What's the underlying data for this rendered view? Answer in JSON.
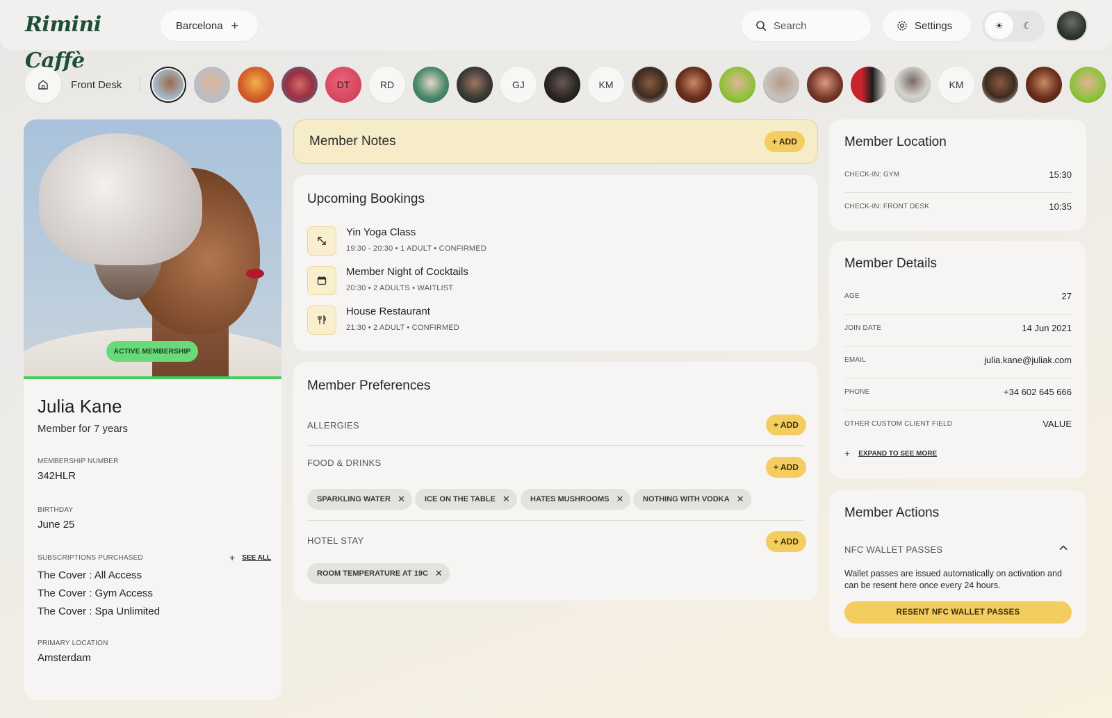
{
  "brand": {
    "logo_text": "Rimini Caffè"
  },
  "header": {
    "location": "Barcelona",
    "search_placeholder": "Search",
    "settings_label": "Settings"
  },
  "desk": {
    "label": "Front Desk"
  },
  "profile": {
    "badge": "ACTIVE MEMBERSHIP",
    "name": "Julia Kane",
    "member_since": "Member for 7 years",
    "membership_number_label": "MEMBERSHIP NUMBER",
    "membership_number": "342HLR",
    "birthday_label": "BIRTHDAY",
    "birthday": "June 25",
    "subscriptions_label": "SUBSCRIPTIONS PURCHASED",
    "see_all": "SEE ALL",
    "subscriptions": [
      "The Cover : All Access",
      "The Cover : Gym Access",
      "The Cover : Spa Unlimited"
    ],
    "primary_location_label": "PRIMARY LOCATION",
    "primary_location": "Amsterdam"
  },
  "notes": {
    "title": "Member Notes",
    "add": "+ ADD"
  },
  "bookings": {
    "title": "Upcoming Bookings",
    "items": [
      {
        "name": "Yin Yoga Class",
        "meta": "19:30 - 20:30 • 1 ADULT • CONFIRMED",
        "icon": "expand-arrows-icon"
      },
      {
        "name": "Member Night of Cocktails",
        "meta": "20:30 • 2 ADULTS • WAITLIST",
        "icon": "calendar-icon"
      },
      {
        "name": "House Restaurant",
        "meta": "21:30 • 2 ADULT • CONFIRMED",
        "icon": "cutlery-icon"
      }
    ]
  },
  "preferences": {
    "title": "Member Preferences",
    "add": "+ ADD",
    "allergies_label": "ALLERGIES",
    "food_label": "FOOD & DRINKS",
    "food_tags": [
      "SPARKLING WATER",
      "ICE ON THE TABLE",
      "HATES MUSHROOMS",
      "NOTHING WITH VODKA"
    ],
    "hotel_label": "HOTEL STAY",
    "hotel_tags": [
      "ROOM TEMPERATURE AT 19C"
    ]
  },
  "location": {
    "title": "Member Location",
    "rows": [
      {
        "k": "CHECK-IN: GYM",
        "v": "15:30"
      },
      {
        "k": "CHECK-IN: FRONT DESK",
        "v": "10:35"
      }
    ]
  },
  "details": {
    "title": "Member Details",
    "rows": [
      {
        "k": "AGE",
        "v": "27"
      },
      {
        "k": "JOIN DATE",
        "v": "14 Jun 2021"
      },
      {
        "k": "EMAIL",
        "v": "julia.kane@juliak.com"
      },
      {
        "k": "PHONE",
        "v": "+34 602 645 666"
      },
      {
        "k": "OTHER CUSTOM CLIENT FIELD",
        "v": "VALUE"
      }
    ],
    "expand": "EXPAND TO SEE MORE"
  },
  "actions": {
    "title": "Member Actions",
    "nfc_label": "NFC WALLET PASSES",
    "nfc_text": "Wallet passes are issued automatically on activation and can be resent here once every 24 hours.",
    "resend": "RESENT NFC WALLET PASSES"
  },
  "member_strip": [
    "",
    "",
    "",
    "",
    "DT",
    "RD",
    "",
    "",
    "GJ",
    "",
    "KM",
    "",
    "",
    "",
    "",
    "",
    "",
    "",
    "KM",
    "",
    "",
    ""
  ],
  "colors": {
    "accent_yellow": "#f4cd60",
    "active_green": "#3ed155",
    "brand_green": "#1f4d3a"
  }
}
